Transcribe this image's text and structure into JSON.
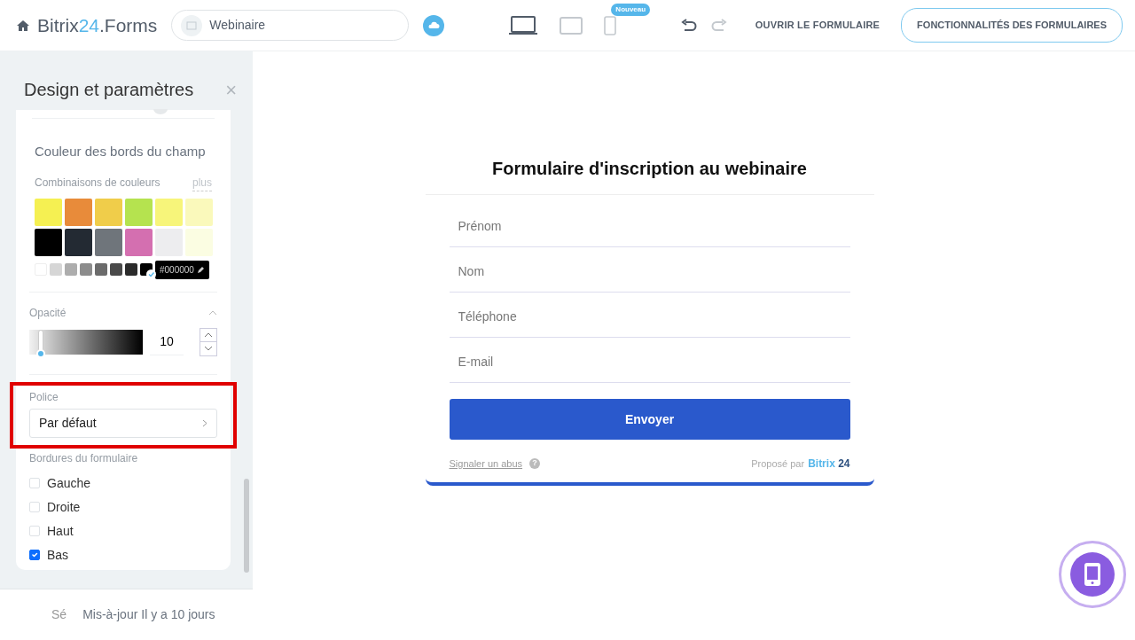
{
  "header": {
    "logo": {
      "brand": "Bitrix",
      "number": "24",
      "suffix": ".Forms"
    },
    "form_name": "Webinaire",
    "devices": [
      {
        "kind": "desktop",
        "selected": true
      },
      {
        "kind": "tablet",
        "selected": false
      },
      {
        "kind": "mobile",
        "selected": false,
        "badge": "Nouveau"
      }
    ],
    "undo": {
      "disabled": false
    },
    "redo": {
      "disabled": true
    },
    "open_link": "OUVRIR LE FORMULAIRE",
    "features_button": "FONCTIONNALITÉS DES FORMULAIRES"
  },
  "sidebar": {
    "title": "Design et paramètres",
    "close": "×",
    "border_color": {
      "title": "Couleur des bords du champ",
      "combos_label": "Combinaisons de couleurs",
      "more": "plus",
      "swatches": [
        {
          "color": "#f5f052"
        },
        {
          "color": "#e88b3a"
        },
        {
          "color": "#f0cd4a"
        },
        {
          "color": "#b5e34f"
        },
        {
          "color": "#f7f57a"
        },
        {
          "color": "#faf9bb"
        },
        {
          "color": "#000000"
        },
        {
          "color": "#232a33"
        },
        {
          "color": "#6f757b"
        },
        {
          "color": "#d46fb0"
        },
        {
          "color": "#ededef"
        },
        {
          "color": "#fbfde2"
        }
      ],
      "grays": [
        {
          "color": "#ffffff",
          "selected": false
        },
        {
          "color": "#d6d6d6",
          "selected": false
        },
        {
          "color": "#adadad",
          "selected": false
        },
        {
          "color": "#8c8c8c",
          "selected": false
        },
        {
          "color": "#6b6b6b",
          "selected": false
        },
        {
          "color": "#4a4a4a",
          "selected": false
        },
        {
          "color": "#2b2b2b",
          "selected": false
        },
        {
          "color": "#000000",
          "selected": true
        }
      ],
      "hex": "#000000"
    },
    "opacity": {
      "label": "Opacité",
      "level": 0.1,
      "value": "10"
    },
    "font": {
      "label": "Police",
      "value": "Par défaut",
      "highlighted": true
    },
    "borders": {
      "label": "Bordures du formulaire",
      "options": [
        {
          "label": "Gauche",
          "checked": false
        },
        {
          "label": "Droite",
          "checked": false
        },
        {
          "label": "Haut",
          "checked": false
        },
        {
          "label": "Bas",
          "checked": true
        }
      ]
    },
    "footer": {
      "cut_text": "Sé",
      "updated": "Mis-à-jour Il y a 10 jours"
    }
  },
  "preview": {
    "title": "Formulaire d'inscription au webinaire",
    "fields": [
      {
        "placeholder": "Prénom"
      },
      {
        "placeholder": "Nom"
      },
      {
        "placeholder": "Téléphone"
      },
      {
        "placeholder": "E-mail"
      }
    ],
    "submit": "Envoyer",
    "report": "Signaler un abus",
    "help": "?",
    "powered_by": "Proposé par",
    "brand": "Bitrix",
    "brand_number": "24"
  }
}
